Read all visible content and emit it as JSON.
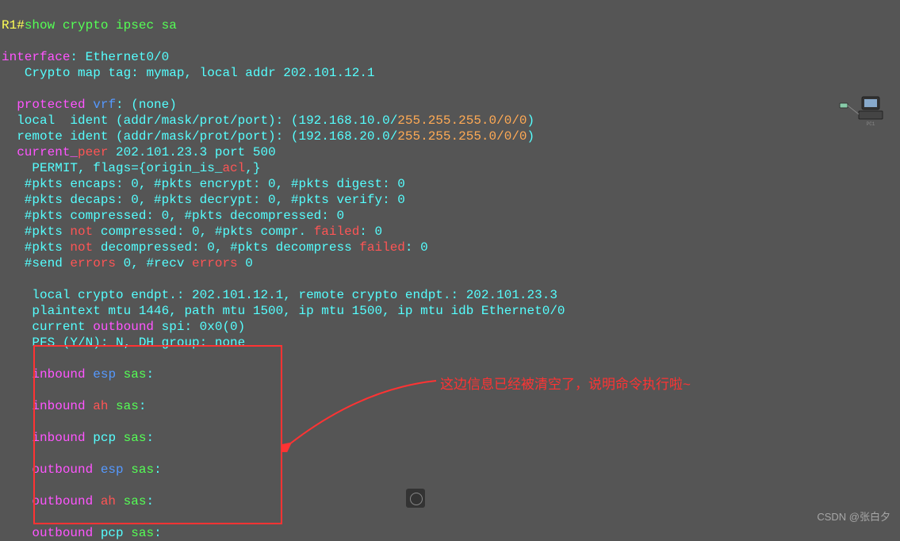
{
  "prompt": "R1#",
  "command": "show crypto ipsec sa",
  "iface_kw": "interface",
  "iface_val": "Ethernet0/0",
  "map_prefix": "Crypto map tag:",
  "map_tag": "mymap",
  "map_mid": ", local addr",
  "map_addr": "202.101.12.1",
  "protected_kw": "  protected",
  "vrf_kw": "vrf",
  "vrf_val": "(none)",
  "local_ident_prefix": "  local  ident (addr/mask/prot/port): (",
  "local_ident_ip": "192.168.10.0",
  "local_ident_rest": "255.255.255.0/0/0",
  "remote_ident_prefix": "  remote ident (addr/mask/prot/port): (",
  "remote_ident_ip": "192.168.20.0",
  "remote_ident_rest": "255.255.255.0/0/0",
  "current_kw": "  current_",
  "peer_kw": "peer",
  "peer_ip": "202.101.23.3",
  "peer_port_word": "port",
  "peer_port": "500",
  "permit_line": "    PERMIT, flags={origin_is_",
  "permit_acl": "acl",
  "permit_end": ",}",
  "l_encaps": "   #pkts encaps: 0, #pkts encrypt: 0, #pkts digest: 0",
  "l_decaps": "   #pkts decaps: 0, #pkts decrypt: 0, #pkts verify: 0",
  "l_compressed": "   #pkts compressed: 0, #pkts decompressed: 0",
  "l_notcomp_a": "   #pkts ",
  "not_kw": "not",
  "l_notcomp_b": " compressed: 0, #pkts compr. ",
  "failed_kw": "failed",
  "l_notcomp_c": ": 0",
  "l_notdecomp_b": " decompressed: 0, #pkts decompress ",
  "send_a": "   #send ",
  "errors_kw": "errors",
  "send_b": " 0, #recv ",
  "send_c": " 0",
  "endpt_a": "    local crypto endpt.: ",
  "endpt_local": "202.101.12.1",
  "endpt_b": ", remote crypto endpt.: ",
  "endpt_remote": "202.101.23.3",
  "mtu_line": "    plaintext mtu 1446, path mtu 1500, ip mtu 1500, ip mtu idb Ethernet0/0",
  "cur_out_a": "    current ",
  "outbound_kw": "outbound",
  "cur_out_b": " spi: ",
  "cur_out_c": "0x0(0)",
  "pfs_line": "    PFS (Y/N): N, DH group: none",
  "in_kw": "inbound",
  "esp_kw": "esp",
  "ah_kw": "ah",
  "pcp_kw": "pcp",
  "sas_kw": "sas",
  "annotation_text": "这边信息已经被清空了，说明命令执行啦~",
  "watermark": "CSDN @张白夕"
}
